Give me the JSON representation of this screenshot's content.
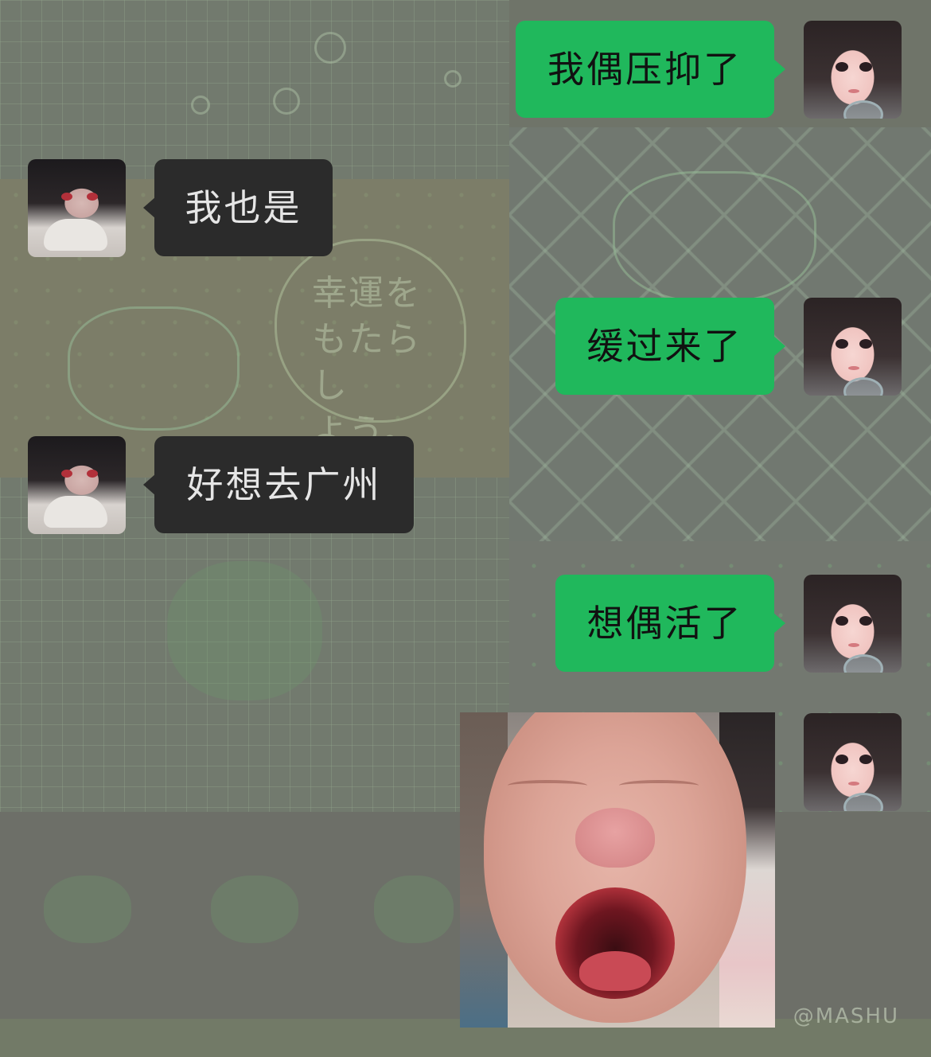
{
  "wallpaper": {
    "note_lines": [
      "幸運を",
      "もたらし",
      "よう。"
    ],
    "watermark": "@MASHU"
  },
  "messages": [
    {
      "side": "out",
      "sender": "girl",
      "text": "我偶压抑了"
    },
    {
      "side": "in",
      "sender": "boy",
      "text": "我也是"
    },
    {
      "side": "out",
      "sender": "girl",
      "text": "缓过来了"
    },
    {
      "side": "in",
      "sender": "boy",
      "text": "好想去广州"
    },
    {
      "side": "out",
      "sender": "girl",
      "text": "想偶活了"
    },
    {
      "side": "out",
      "sender": "girl",
      "type": "sticker",
      "sticker": "crying-baby"
    }
  ],
  "colors": {
    "outgoing_bubble": "#20b85c",
    "incoming_bubble": "#2b2b2b",
    "outgoing_text": "#111111",
    "incoming_text": "#e6e6e6"
  }
}
